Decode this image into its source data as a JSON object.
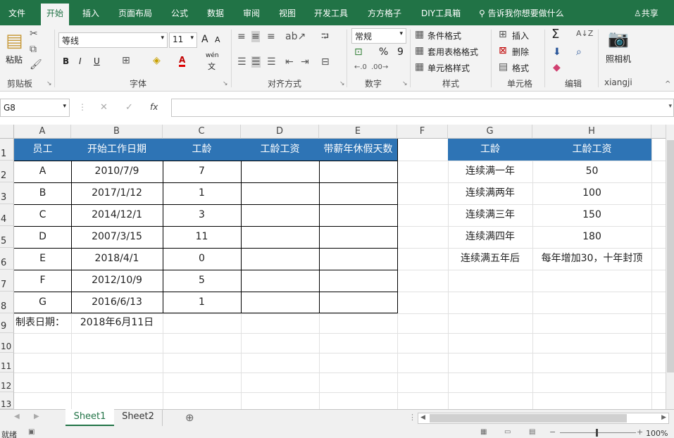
{
  "menu": {
    "tabs": [
      "文件",
      "开始",
      "插入",
      "页面布局",
      "公式",
      "数据",
      "审阅",
      "视图",
      "开发工具",
      "方方格子",
      "DIY工具箱"
    ],
    "active_tab": "开始",
    "search_text": "告诉我你想要做什么",
    "share_label": "共享"
  },
  "ribbon": {
    "clipboard": {
      "paste_label": "粘贴",
      "group_label": "剪贴板"
    },
    "font": {
      "font_name": "等线",
      "font_size": "11",
      "bold": "B",
      "italic": "I",
      "underline": "U",
      "font_color_icon": "A",
      "phonetic_top": "wén",
      "phonetic_bottom": "文",
      "grow_font": "A",
      "shrink_font": "A",
      "group_label": "字体"
    },
    "alignment": {
      "group_label": "对齐方式"
    },
    "number": {
      "format": "常规",
      "percent": "%",
      "comma": "9",
      "group_label": "数字"
    },
    "styles": {
      "conditional": "条件格式",
      "table": "套用表格格式",
      "cell_styles": "单元格样式",
      "group_label": "样式"
    },
    "cells": {
      "insert": "插入",
      "delete": "删除",
      "format": "格式",
      "group_label": "单元格"
    },
    "editing": {
      "sum_icon": "Σ",
      "group_label": "编辑"
    },
    "camera": {
      "label": "照相机",
      "group_label": "xiangji"
    }
  },
  "formula_bar": {
    "name_box": "G8",
    "cancel": "✕",
    "enter": "✓",
    "fx": "fx",
    "content": ""
  },
  "grid": {
    "columns": [
      "A",
      "B",
      "C",
      "D",
      "E",
      "F",
      "G",
      "H"
    ],
    "rows": [
      "1",
      "2",
      "3",
      "4",
      "5",
      "6",
      "7",
      "8",
      "9",
      "10",
      "11",
      "12",
      "13"
    ],
    "table1": {
      "headers": [
        "员工",
        "开始工作日期",
        "工龄",
        "工龄工资",
        "带薪年休假天数"
      ],
      "rows": [
        [
          "A",
          "2010/7/9",
          "7",
          "",
          ""
        ],
        [
          "B",
          "2017/1/12",
          "1",
          "",
          ""
        ],
        [
          "C",
          "2014/12/1",
          "3",
          "",
          ""
        ],
        [
          "D",
          "2007/3/15",
          "11",
          "",
          ""
        ],
        [
          "E",
          "2018/4/1",
          "0",
          "",
          ""
        ],
        [
          "F",
          "2012/10/9",
          "5",
          "",
          ""
        ],
        [
          "G",
          "2016/6/13",
          "1",
          "",
          ""
        ]
      ],
      "date_label": "制表日期：",
      "date_value": "2018年6月11日"
    },
    "table2": {
      "headers": [
        "工龄",
        "工龄工资"
      ],
      "rows": [
        [
          "连续满一年",
          "50"
        ],
        [
          "连续满两年",
          "100"
        ],
        [
          "连续满三年",
          "150"
        ],
        [
          "连续满四年",
          "180"
        ],
        [
          "连续满五年后",
          "每年增加30，十年封顶"
        ]
      ]
    }
  },
  "sheets": {
    "tabs": [
      "Sheet1",
      "Sheet2"
    ],
    "active": "Sheet1",
    "add": "⊕"
  },
  "status": {
    "ready": "就绪",
    "zoom": "100%"
  },
  "colors": {
    "excel_green": "#217346",
    "header_blue": "#2e74b5"
  }
}
